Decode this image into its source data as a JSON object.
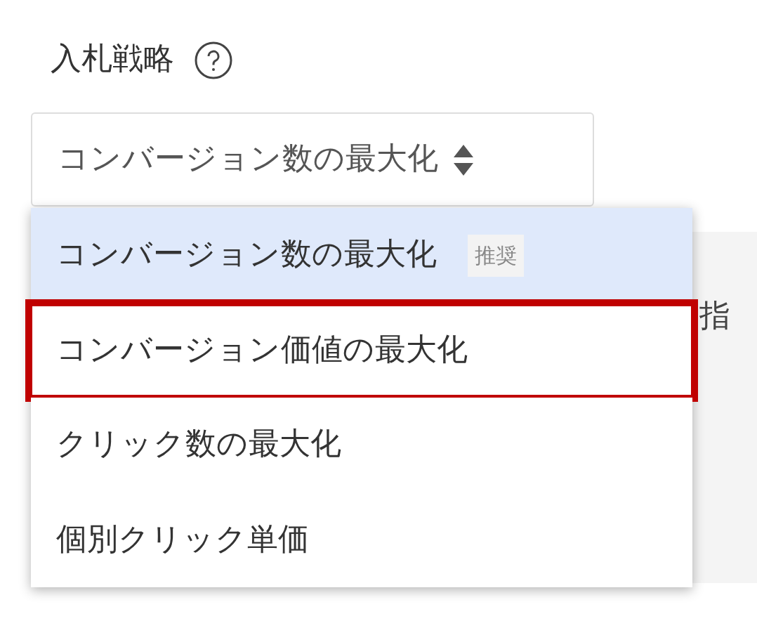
{
  "field": {
    "label": "入札戦略",
    "value": "コンバージョン数の最大化"
  },
  "options": [
    {
      "label": "コンバージョン数の最大化",
      "selected": true,
      "badge": "推奨",
      "highlighted": false
    },
    {
      "label": "コンバージョン価値の最大化",
      "selected": false,
      "highlighted": true
    },
    {
      "label": "クリック数の最大化",
      "selected": false,
      "highlighted": false
    },
    {
      "label": "個別クリック単価",
      "selected": false,
      "highlighted": false
    }
  ],
  "background_panel": {
    "text": "指"
  }
}
